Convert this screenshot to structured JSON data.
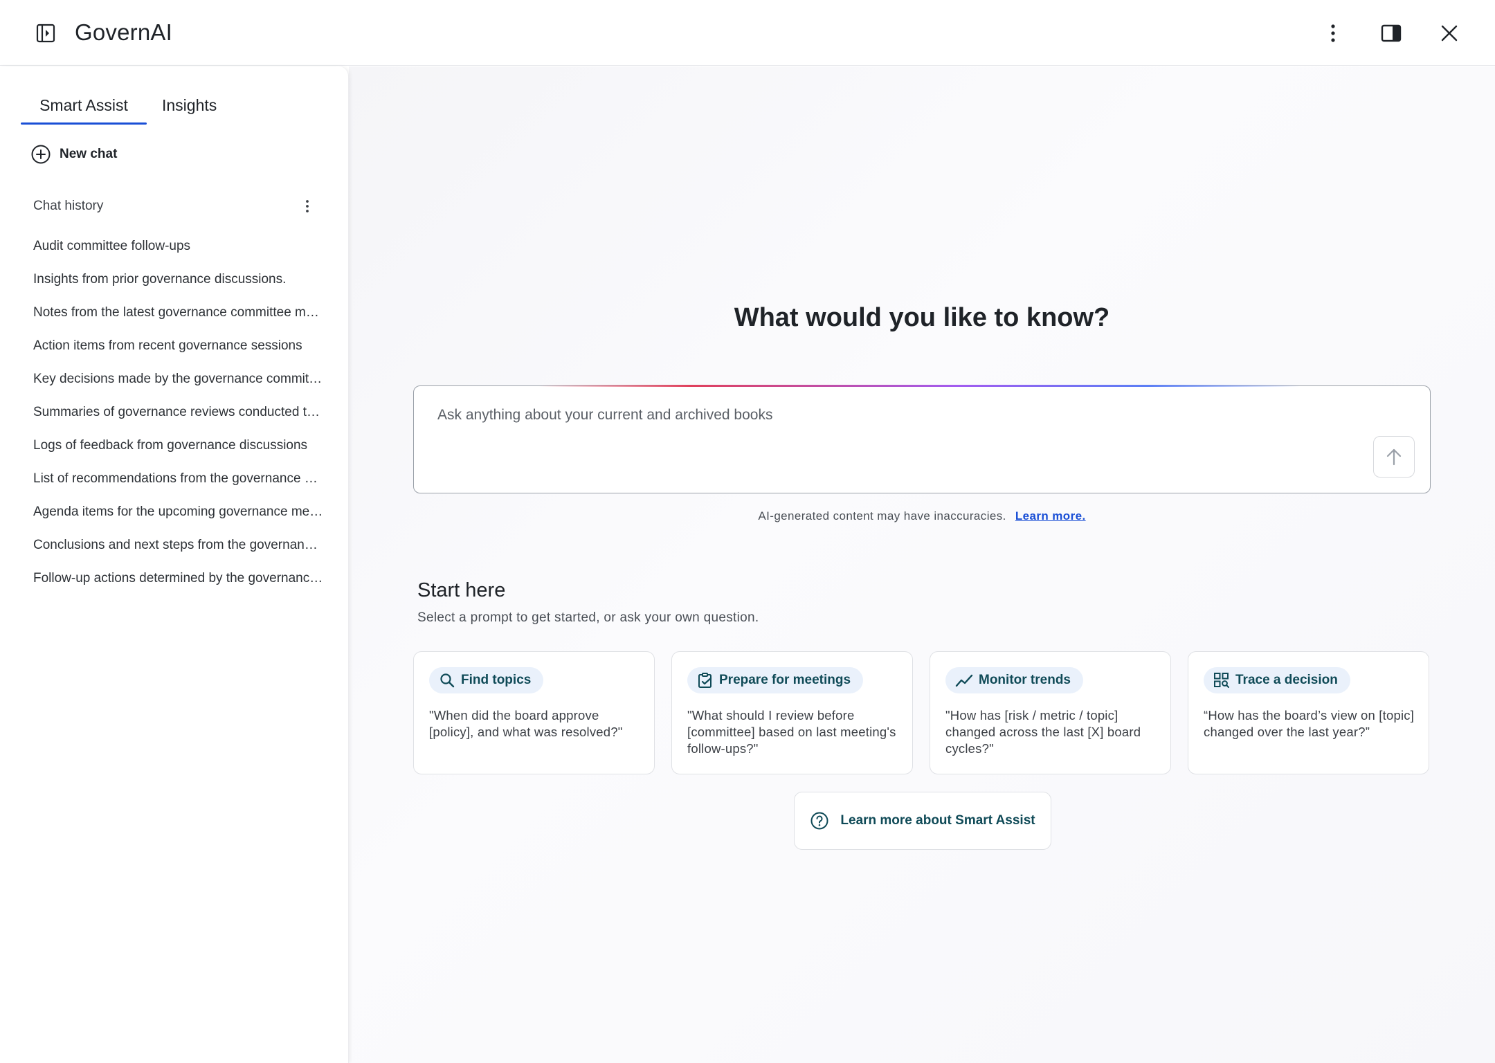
{
  "header": {
    "title": "GovernAI",
    "icons": {
      "sidebar_toggle": "panel-toggle-icon",
      "more": "kebab-icon",
      "side_panel": "side-panel-icon",
      "close": "close-icon"
    }
  },
  "sidebar": {
    "tabs": [
      {
        "label": "Smart Assist",
        "active": true
      },
      {
        "label": "Insights",
        "active": false
      }
    ],
    "new_chat_label": "New chat",
    "history_title": "Chat history",
    "history": [
      "Audit committee follow-ups",
      "Insights from prior governance discussions.",
      "Notes from the latest governance committee meeting",
      "Action items from recent governance sessions",
      "Key decisions made by the governance committee",
      "Summaries of governance reviews conducted this year",
      "Logs of feedback from governance discussions",
      "List of recommendations from the governance board",
      "Agenda items for the upcoming governance meeting",
      "Conclusions and next steps from the governance review",
      "Follow-up actions determined by the governance board"
    ]
  },
  "main": {
    "headline": "What would you like to know?",
    "ask": {
      "placeholder": "Ask anything about your current and archived books",
      "value": ""
    },
    "disclaimer": "AI-generated content may have inaccuracies.",
    "disclaimer_link": "Learn more.",
    "start_title": "Start here",
    "start_subtitle": "Select a prompt to get started, or ask your own question.",
    "cards": [
      {
        "label": "Find topics",
        "icon": "search-icon",
        "text": "\"When did the board approve [policy], and what was resolved?\""
      },
      {
        "label": "Prepare for meetings",
        "icon": "clipboard-check-icon",
        "text": "\"What should I review before [committee] based on last meeting's follow-ups?\""
      },
      {
        "label": "Monitor trends",
        "icon": "trend-line-icon",
        "text": "\"How has [risk / metric / topic] changed across the last [X] board cycles?\""
      },
      {
        "label": "Trace a decision",
        "icon": "grid-search-icon",
        "text": "“How has the board’s view on [topic] changed over the last year?”"
      }
    ],
    "learn_more_label": "Learn more about Smart Assist"
  },
  "colors": {
    "accent": "#1a4fd6",
    "chip_bg": "#eaf1fb",
    "chip_text": "#0f4a57"
  }
}
